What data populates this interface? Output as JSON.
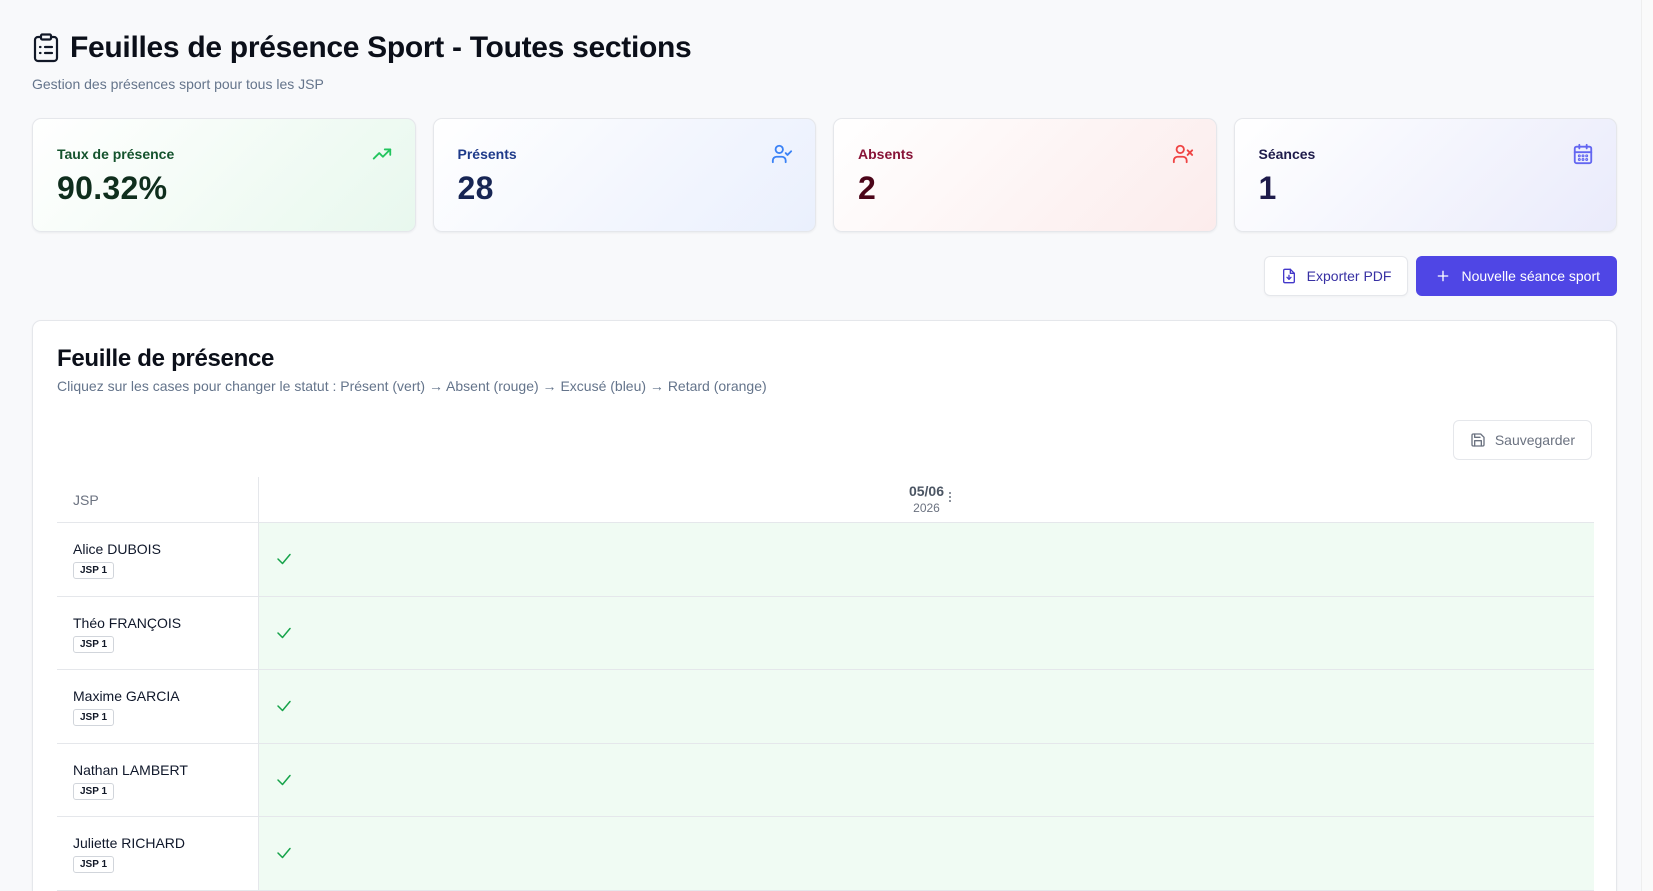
{
  "header": {
    "title": "Feuilles de présence Sport - Toutes sections",
    "subtitle": "Gestion des présences sport pour tous les JSP",
    "icon": "clipboard-list-icon"
  },
  "stats": [
    {
      "label": "Taux de présence",
      "value": "90.32%",
      "icon": "trending-up-icon",
      "accent": "#22c55e"
    },
    {
      "label": "Présents",
      "value": "28",
      "icon": "user-check-icon",
      "accent": "#3b82f6"
    },
    {
      "label": "Absents",
      "value": "2",
      "icon": "user-x-icon",
      "accent": "#ef4444"
    },
    {
      "label": "Séances",
      "value": "1",
      "icon": "calendar-icon",
      "accent": "#6366f1"
    }
  ],
  "actions": {
    "export_label": "Exporter PDF",
    "new_label": "Nouvelle séance sport"
  },
  "sheet": {
    "title": "Feuille de présence",
    "subtitle": "Cliquez sur les cases pour changer le statut : Présent (vert) → Absent (rouge) → Excusé (bleu) → Retard (orange)",
    "save_label": "Sauvegarder",
    "columns": {
      "name_header": "JSP",
      "date": "05/06",
      "year": "2026"
    },
    "rows": [
      {
        "name": "Alice DUBOIS",
        "group": "JSP 1",
        "status": "present"
      },
      {
        "name": "Théo FRANÇOIS",
        "group": "JSP 1",
        "status": "present"
      },
      {
        "name": "Maxime GARCIA",
        "group": "JSP 1",
        "status": "present"
      },
      {
        "name": "Nathan LAMBERT",
        "group": "JSP 1",
        "status": "present"
      },
      {
        "name": "Juliette RICHARD",
        "group": "JSP 1",
        "status": "present"
      }
    ]
  },
  "colors": {
    "primary": "#4f46e5",
    "present_bg": "#f0fbf3",
    "present_check": "#16a34a"
  }
}
